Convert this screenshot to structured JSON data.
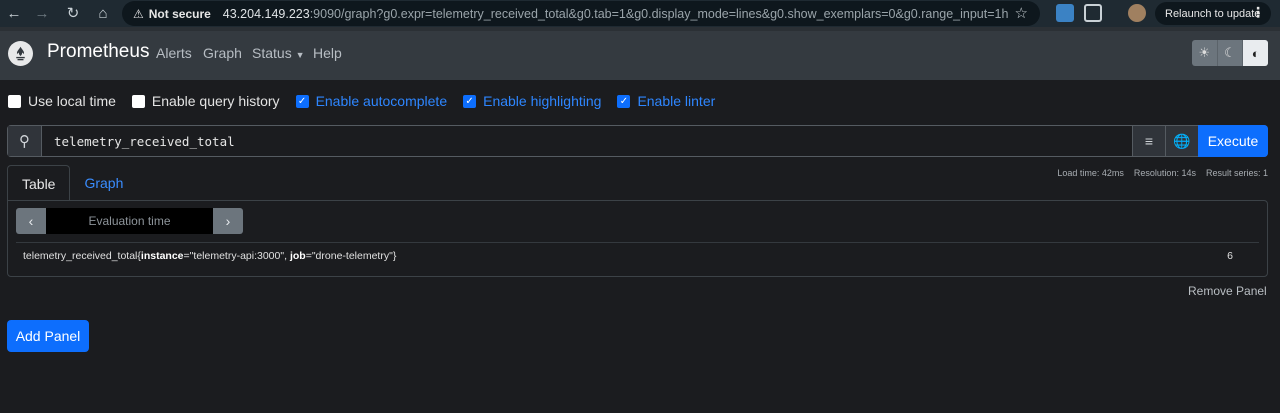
{
  "browser": {
    "security_label": "Not secure",
    "url_host": "43.204.149.223",
    "url_rest": ":9090/graph?g0.expr=telemetry_received_total&g0.tab=1&g0.display_mode=lines&g0.show_exemplars=0&g0.range_input=1h",
    "relaunch_label": "Relaunch to update"
  },
  "nav": {
    "brand": "Prometheus",
    "links": [
      "Alerts",
      "Graph",
      "Status",
      "Help"
    ]
  },
  "options": [
    {
      "label": "Use local time",
      "checked": false
    },
    {
      "label": "Enable query history",
      "checked": false
    },
    {
      "label": "Enable autocomplete",
      "checked": true
    },
    {
      "label": "Enable highlighting",
      "checked": true
    },
    {
      "label": "Enable linter",
      "checked": true
    }
  ],
  "query": {
    "expression": "telemetry_received_total",
    "execute_label": "Execute"
  },
  "stats": {
    "load_time": "Load time: 42ms",
    "resolution": "Resolution: 14s",
    "result_series": "Result series: 1"
  },
  "panel": {
    "tabs": [
      "Table",
      "Graph"
    ],
    "eval_placeholder": "Evaluation time",
    "result": {
      "metric": "telemetry_received_total",
      "label1_key": "instance",
      "label1_val": "\"telemetry-api:3000\"",
      "label2_key": "job",
      "label2_val": "\"drone-telemetry\"",
      "value": "6"
    },
    "remove_label": "Remove Panel"
  },
  "add_panel_label": "Add Panel",
  "colors": {
    "primary": "#0d6efd",
    "nav_bg": "#343a40",
    "page_bg": "#1b1c1f"
  }
}
